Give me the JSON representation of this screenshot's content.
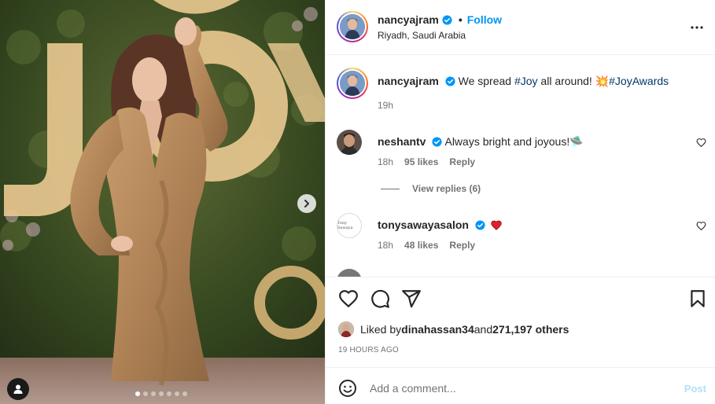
{
  "post": {
    "author": {
      "username": "nancyajram",
      "verified": true,
      "follow_label": "Follow",
      "location": "Riyadh, Saudi Arabia",
      "separator": "•"
    },
    "media": {
      "carousel_count": 7,
      "carousel_active_index": 0,
      "backdrop_letters": "JOY"
    },
    "caption": {
      "username": "nancyajram",
      "text": "We spread ",
      "hashtag1": "#Joy",
      "text2": " all around! ",
      "emoji": "💥",
      "hashtag2": "#JoyAwards",
      "time": "19h"
    },
    "comments": [
      {
        "username": "neshantv",
        "verified": true,
        "text": "Always bright and joyous!",
        "emoji": "🛸",
        "time": "18h",
        "likes": "95 likes",
        "reply_label": "Reply"
      },
      {
        "username": "tonysawayasalon",
        "verified": true,
        "text": "",
        "emoji": "❤️",
        "time": "18h",
        "likes": "48 likes",
        "reply_label": "Reply",
        "avatar_text": "Tony Sawaya"
      }
    ],
    "view_replies": "View replies (6)",
    "liked_by": {
      "prefix": "Liked by ",
      "user": "dinahassan34",
      "middle": " and ",
      "others": "271,197 others"
    },
    "timestamp": "19 HOURS AGO",
    "composer": {
      "placeholder": "Add a comment...",
      "post_label": "Post"
    }
  },
  "colors": {
    "accent": "#0095f6",
    "hashtag": "#00376b",
    "muted": "#737373",
    "post_disabled": "#b2dffc",
    "heart_red": "#ed4956"
  }
}
